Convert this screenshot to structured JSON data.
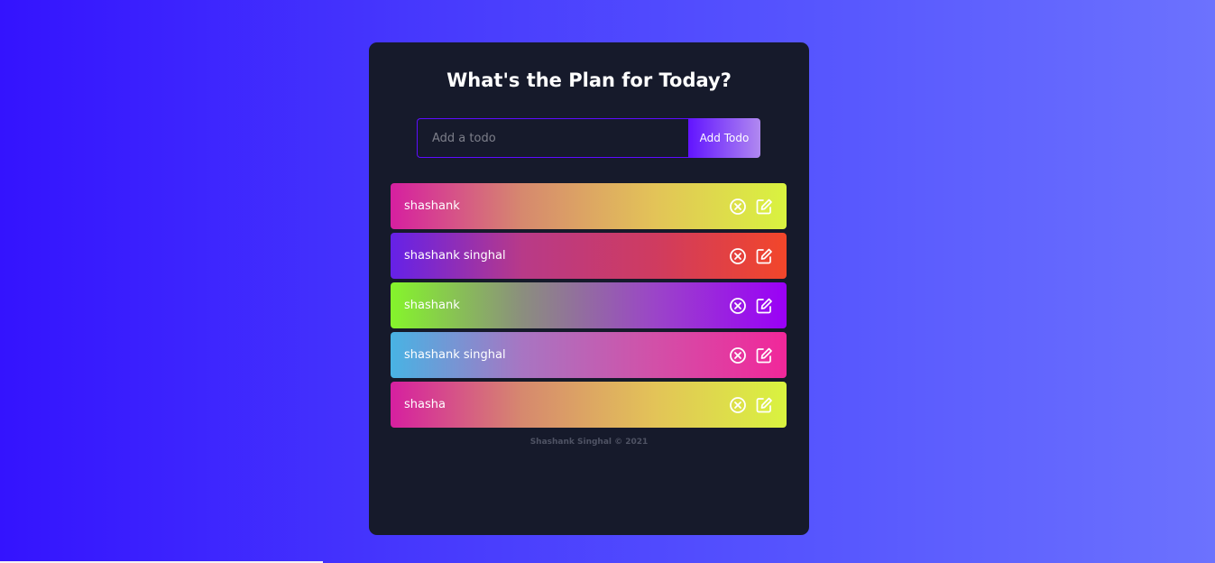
{
  "app": {
    "title": "What's the Plan for Today?",
    "input_placeholder": "Add a todo",
    "input_value": "",
    "add_button_label": "Add Todo",
    "footer": "Shashank Singhal © 2021"
  },
  "todos": [
    {
      "text": "shashank",
      "gradient": [
        "#d61fa0",
        "#d6896e",
        "#e3c358",
        "#d9f33f"
      ]
    },
    {
      "text": "shashank singhal",
      "gradient": [
        "#6521e8",
        "#b83a88",
        "#cf3b60",
        "#f2462a"
      ]
    },
    {
      "text": "shashank",
      "gradient": [
        "#85f52b",
        "#8b8e7e",
        "#9b45c8",
        "#9a00f7"
      ]
    },
    {
      "text": "shashank singhal",
      "gradient": [
        "#48b3e4",
        "#a875c2",
        "#d250a8",
        "#f1279a"
      ]
    },
    {
      "text": "shasha",
      "gradient": [
        "#d61fa0",
        "#d6896e",
        "#e3c358",
        "#d9f33f"
      ]
    }
  ],
  "colors": {
    "background_start": "#3413fe",
    "background_end": "#6c72fe",
    "card": "#161a2b",
    "accent": "#5d0cff"
  },
  "icons": {
    "delete": "close-circle-icon",
    "edit": "edit-icon"
  }
}
